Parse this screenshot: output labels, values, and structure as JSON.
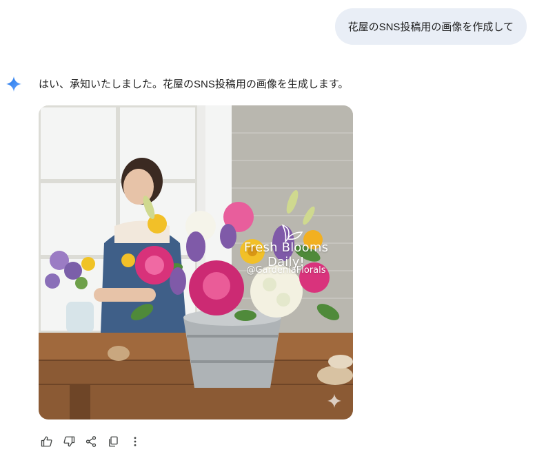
{
  "user_message": {
    "text": "花屋のSNS投稿用の画像を作成して"
  },
  "response": {
    "text": "はい、承知いたしました。花屋のSNS投稿用の画像を生成します。",
    "image": {
      "overlay_heading": "Fresh Blooms Daily!",
      "overlay_handle": "@GardeniaFlorals"
    }
  },
  "actions": [
    {
      "name": "thumbs-up-icon"
    },
    {
      "name": "thumbs-down-icon"
    },
    {
      "name": "share-icon"
    },
    {
      "name": "copy-icon"
    },
    {
      "name": "more-vert-icon"
    }
  ],
  "colors": {
    "user_bubble_bg": "#e9eef6",
    "spark_blue": "#4285f4",
    "icon_gray": "#444746"
  }
}
